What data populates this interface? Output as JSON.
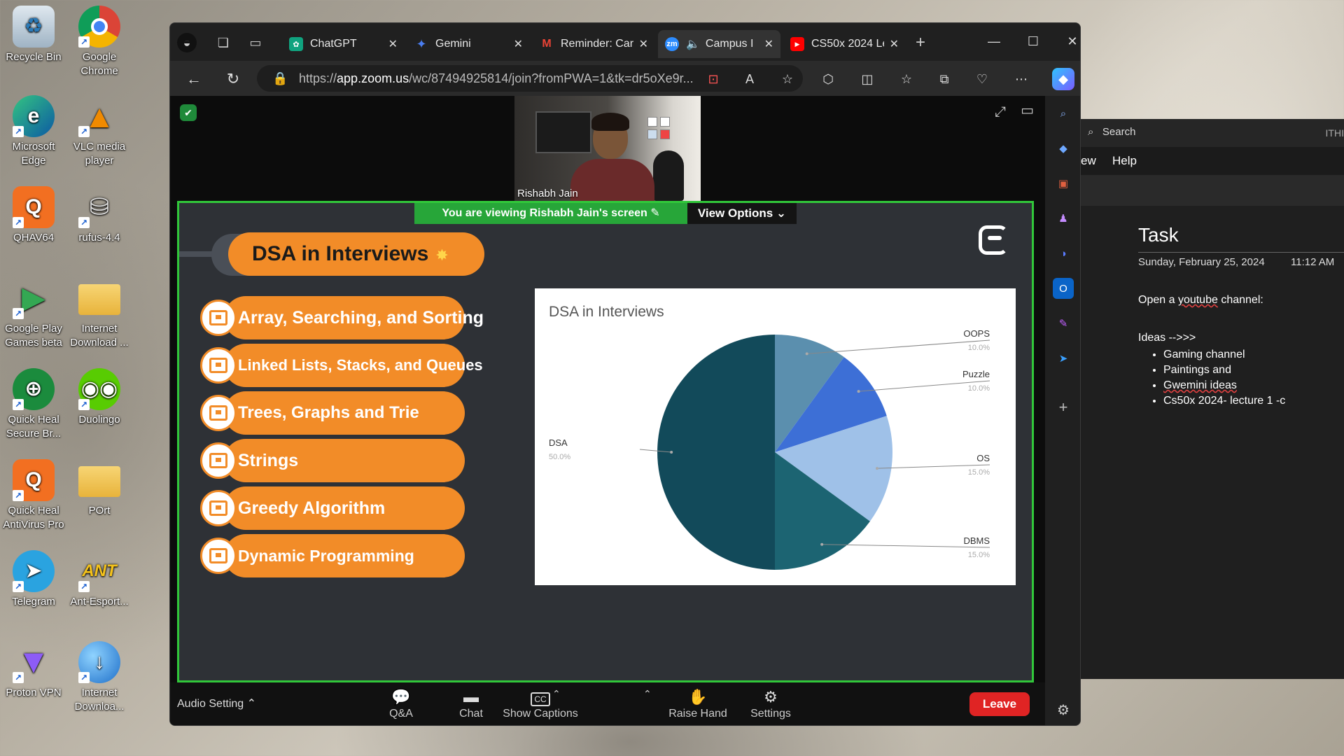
{
  "desktop": {
    "icons": [
      {
        "label": "Recycle Bin",
        "icon": "recycle-bin-icon"
      },
      {
        "label": "Google Chrome",
        "icon": "chrome-icon"
      },
      {
        "label": "Microsoft Edge",
        "icon": "edge-icon"
      },
      {
        "label": "VLC media player",
        "icon": "vlc-icon"
      },
      {
        "label": "QHAV64",
        "icon": "quickheal-icon"
      },
      {
        "label": "rufus-4.4",
        "icon": "rufus-icon"
      },
      {
        "label": "Google Play Games beta",
        "icon": "google-play-games-icon"
      },
      {
        "label": "Internet Download ...",
        "icon": "folder-icon"
      },
      {
        "label": "Quick Heal Secure Br...",
        "icon": "quickheal-browser-icon"
      },
      {
        "label": "Duolingo",
        "icon": "duolingo-icon"
      },
      {
        "label": "Quick Heal AntiVirus Pro",
        "icon": "quickheal-av-icon"
      },
      {
        "label": "POrt",
        "icon": "folder-icon"
      },
      {
        "label": "Telegram",
        "icon": "telegram-icon"
      },
      {
        "label": "Ant-Esport...",
        "icon": "ant-esports-icon"
      },
      {
        "label": "Proton VPN",
        "icon": "proton-vpn-icon"
      },
      {
        "label": "Internet Downloa...",
        "icon": "idm-icon"
      }
    ]
  },
  "browser": {
    "tabs": [
      {
        "title": "ChatGPT",
        "icon": "chatgpt-icon",
        "color": "#10a37f"
      },
      {
        "title": "Gemini",
        "icon": "gemini-icon",
        "color": "#4a7df0"
      },
      {
        "title": "Reminder: Car",
        "icon": "gmail-icon",
        "color": "#ea4335"
      },
      {
        "title": "Campus I",
        "icon": "zoom-icon",
        "color": "#2d8cff"
      },
      {
        "title": "CS50x 2024 Le",
        "icon": "youtube-icon",
        "color": "#ff0000"
      }
    ],
    "url_prefix": "https://",
    "url_host": "app.zoom.us",
    "url_rest": "/wc/87494925814/join?fromPWA=1&tk=dr5oXe9r..."
  },
  "zoom": {
    "participant_name": "Rishabh Jain",
    "viewing_banner": "You are viewing  Rishabh Jain's screen",
    "view_options": "View Options",
    "slide": {
      "title": "DSA in Interviews",
      "topics": [
        "Array, Searching, and Sorting",
        "Linked Lists, Stacks, and Queues",
        "Trees, Graphs and Trie",
        "Strings",
        "Greedy Algorithm",
        "Dynamic Programming"
      ]
    },
    "toolbar": {
      "audio_setting": "Audio Setting",
      "qa": "Q&A",
      "chat": "Chat",
      "show_captions": "Show Captions",
      "raise_hand": "Raise Hand",
      "settings": "Settings",
      "leave": "Leave"
    }
  },
  "chart_data": {
    "type": "pie",
    "title": "DSA in Interviews",
    "slices": [
      {
        "label": "OOPS",
        "pct_label": "10.0%",
        "value": 10,
        "color": "#5b8fae"
      },
      {
        "label": "Puzzle",
        "pct_label": "10.0%",
        "value": 10,
        "color": "#3d6fd6"
      },
      {
        "label": "OS",
        "pct_label": "15.0%",
        "value": 15,
        "color": "#9fc1e8"
      },
      {
        "label": "DBMS",
        "pct_label": "15.0%",
        "value": 15,
        "color": "#1c6472"
      },
      {
        "label": "DSA",
        "pct_label": "50.0%",
        "value": 50,
        "color": "#124a5a"
      }
    ]
  },
  "onenote": {
    "search": "Search",
    "ith": "ITHI",
    "menu_view": "ew",
    "menu_help": "Help",
    "title": "Task",
    "date": "Sunday, February 25, 2024",
    "time": "11:12 AM",
    "line1_prefix": "Open a ",
    "line1_word": "youtube",
    "line1_suffix": " channel:",
    "ideas_label": "Ideas -->>>",
    "ideas": [
      "Gaming channel",
      "Paintings and",
      "Gwemini ideas",
      "Cs50x 2024- lecture 1 -c"
    ]
  }
}
